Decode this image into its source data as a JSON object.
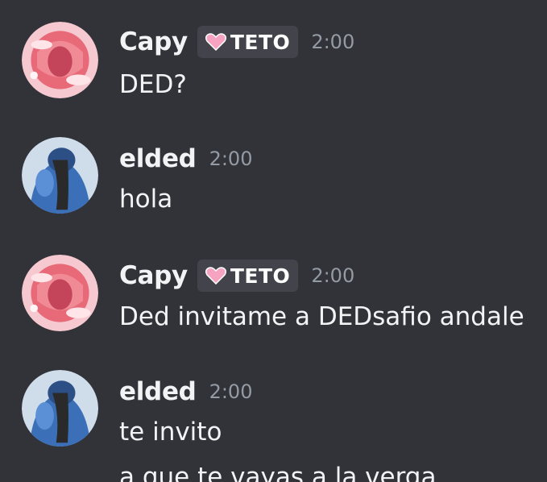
{
  "messages": [
    {
      "username": "Capy",
      "tag": "TETO",
      "time": "2:00",
      "lines": [
        "DED?"
      ]
    },
    {
      "username": "elded",
      "time": "2:00",
      "lines": [
        "hola"
      ]
    },
    {
      "username": "Capy",
      "tag": "TETO",
      "time": "2:00",
      "lines": [
        "Ded invitame a DEDsafio andale"
      ]
    },
    {
      "username": "elded",
      "time": "2:00",
      "lines": [
        "te invito",
        "a que te vayas a la verga"
      ]
    }
  ],
  "colors": {
    "background": "#313338",
    "username": "#f2f3f5",
    "timestamp": "#949ba4",
    "tag_background": "#43444b",
    "tag_heart": "#f5a3c0"
  },
  "icons": {
    "tag": "heart-icon"
  }
}
